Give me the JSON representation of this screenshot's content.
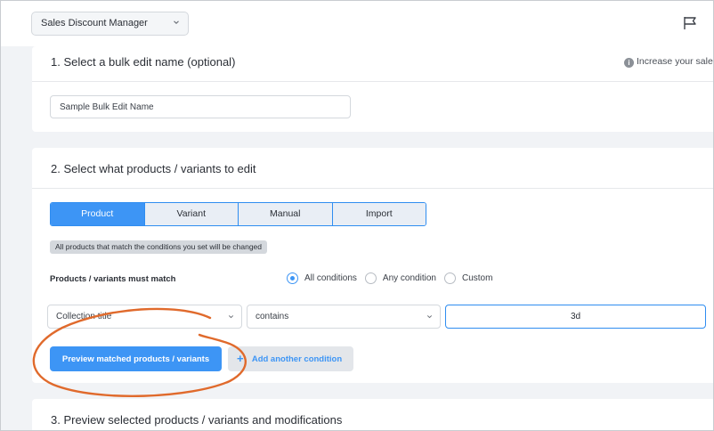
{
  "header": {
    "app_selector": "Sales Discount Manager",
    "flag_icon": "flag-icon"
  },
  "step1": {
    "title": "1. Select a bulk edit name (optional)",
    "hint": "Increase your sales",
    "name_input_value": "Sample Bulk Edit Name"
  },
  "step2": {
    "title": "2. Select what products / variants to edit",
    "tabs": [
      {
        "label": "Product",
        "active": true
      },
      {
        "label": "Variant",
        "active": false
      },
      {
        "label": "Manual",
        "active": false
      },
      {
        "label": "Import",
        "active": false
      }
    ],
    "note": "All products that match the conditions you set will be changed",
    "match_label": "Products / variants must match",
    "match_options": [
      {
        "label": "All conditions",
        "selected": true
      },
      {
        "label": "Any condition",
        "selected": false
      },
      {
        "label": "Custom",
        "selected": false
      }
    ],
    "condition": {
      "field": "Collection title",
      "operator": "contains",
      "value": "3d"
    },
    "preview_button": "Preview matched products / variants",
    "add_condition_button": "Add another condition"
  },
  "step3": {
    "title": "3. Preview selected products / variants and modifications"
  },
  "colors": {
    "accent": "#3d95f5",
    "highlight_circle": "#e06a2c",
    "background": "#f1f3f6"
  }
}
